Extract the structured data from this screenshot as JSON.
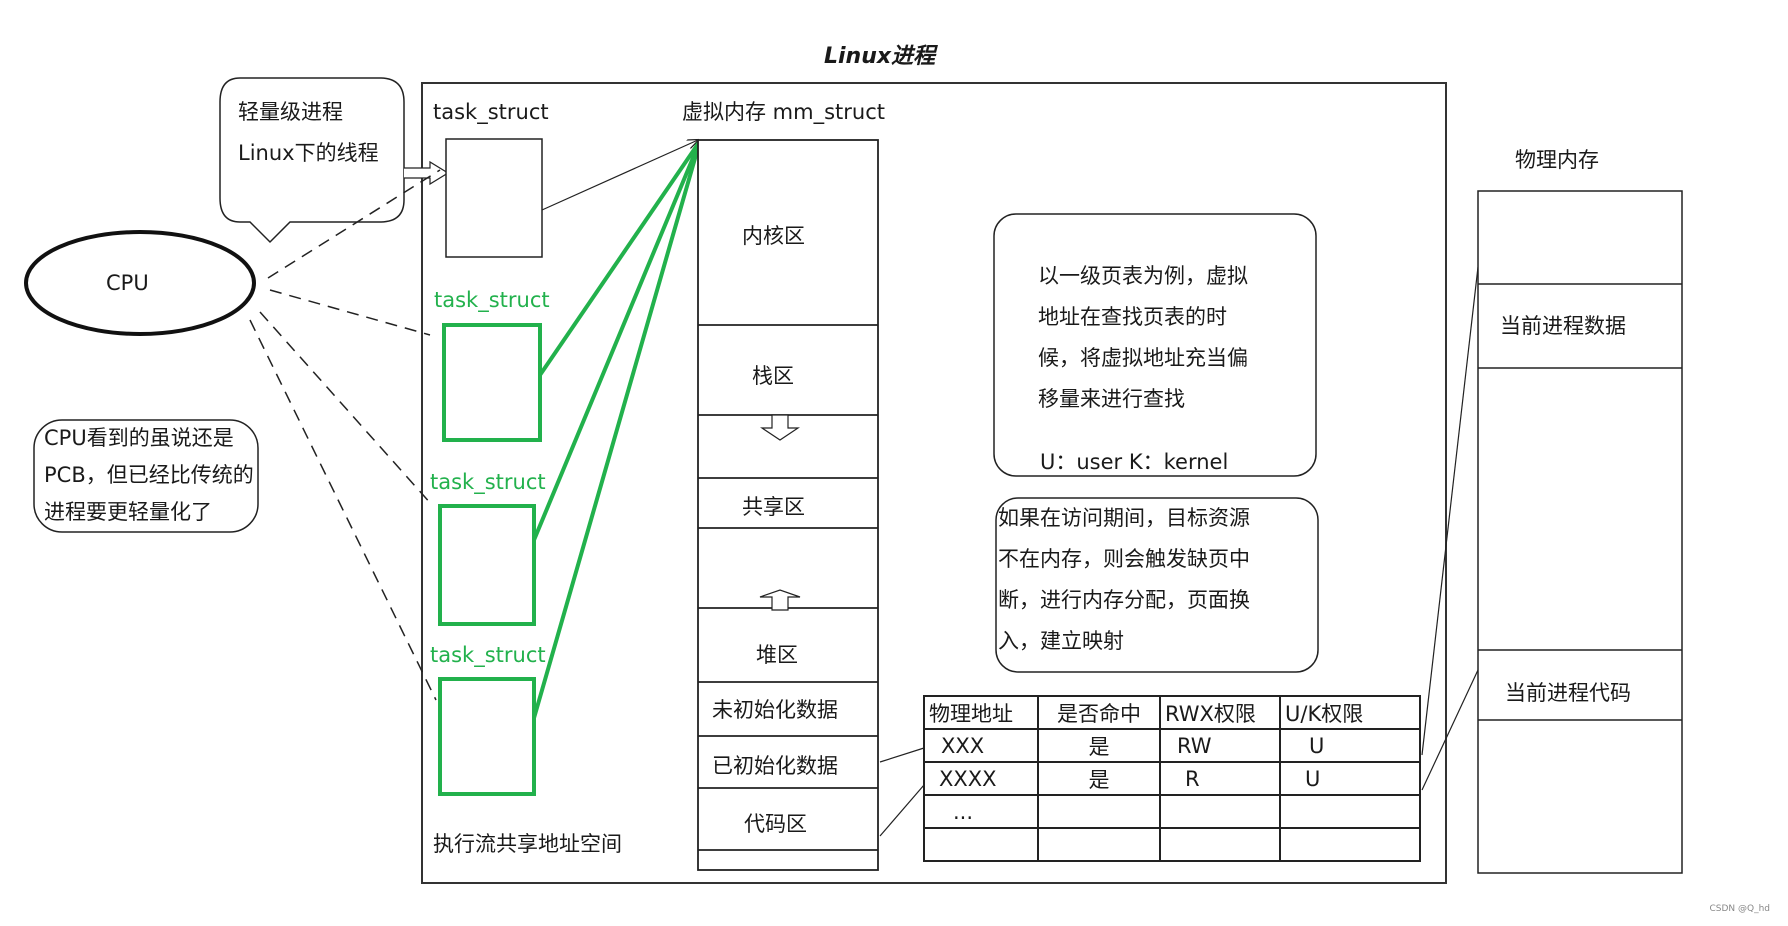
{
  "title": "Linux进程",
  "cpu": {
    "label": "CPU"
  },
  "callouts": {
    "lwp": [
      "轻量级进程",
      "Linux下的线程"
    ],
    "cpu_view": [
      "CPU看到的虽说还是",
      "PCB，但已经比传统的",
      "进程要更轻量化了"
    ]
  },
  "tasks": {
    "main_label": "task_struct",
    "thread_labels": [
      "task_struct",
      "task_struct",
      "task_struct"
    ],
    "shared_space_label": "执行流共享地址空间"
  },
  "virtual_memory": {
    "label": "虚拟内存 mm_struct",
    "regions": [
      "内核区",
      "栈区",
      "共享区",
      "堆区",
      "未初始化数据",
      "已初始化数据",
      "代码区"
    ]
  },
  "notes": {
    "page_table_note": [
      "以一级页表为例，虚拟",
      "地址在查找页表的时",
      "候，将虚拟地址充当偏",
      "移量来进行查找"
    ],
    "uk_legend": "U：user  K：kernel",
    "page_fault_note": [
      "如果在访问期间，目标资源",
      "不在内存，则会触发缺页中",
      "断，进行内存分配，页面换",
      "入，建立映射"
    ]
  },
  "page_table": {
    "headers": [
      "物理地址",
      "是否命中",
      "RWX权限",
      "U/K权限"
    ],
    "rows": [
      [
        "XXX",
        "是",
        "RW",
        "U"
      ],
      [
        "XXXX",
        "是",
        "R",
        "U"
      ],
      [
        "...",
        "",
        "",
        ""
      ],
      [
        "",
        "",
        "",
        ""
      ]
    ]
  },
  "physical_memory": {
    "label": "物理内存",
    "blocks": [
      "",
      "当前进程数据",
      "",
      "当前进程代码",
      ""
    ]
  },
  "colors": {
    "thread": "#22b14c",
    "line": "#1a1a1a"
  },
  "watermark": "CSDN @Q_hd"
}
